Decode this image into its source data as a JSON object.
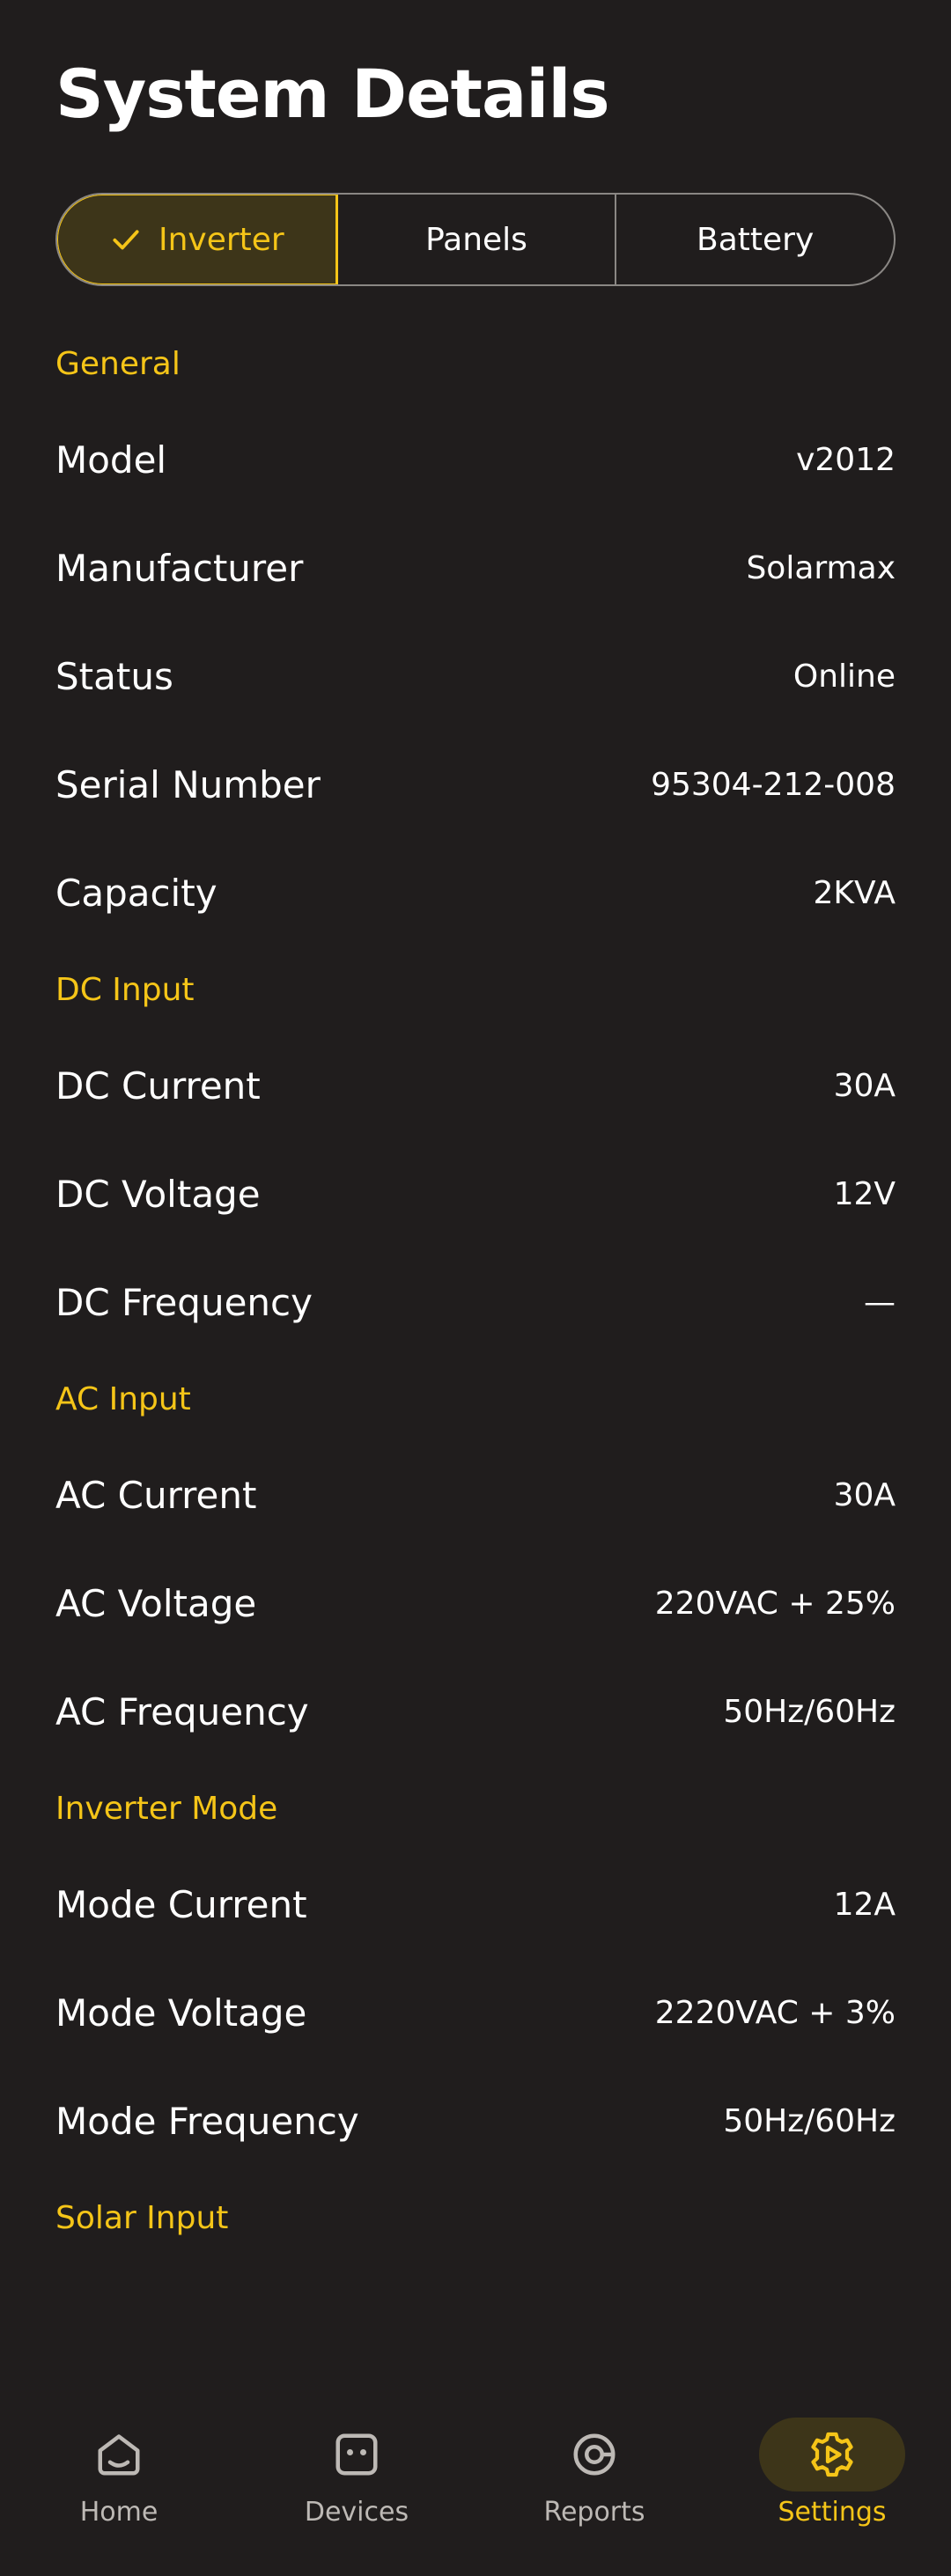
{
  "title": "System Details",
  "tabs": [
    {
      "label": "Inverter",
      "selected": true
    },
    {
      "label": "Panels",
      "selected": false
    },
    {
      "label": "Battery",
      "selected": false
    }
  ],
  "sections": [
    {
      "header": "General",
      "rows": [
        {
          "label": "Model",
          "value": "v2012"
        },
        {
          "label": "Manufacturer",
          "value": "Solarmax"
        },
        {
          "label": "Status",
          "value": "Online"
        },
        {
          "label": "Serial Number",
          "value": "95304-212-008"
        },
        {
          "label": "Capacity",
          "value": "2KVA"
        }
      ]
    },
    {
      "header": "DC Input",
      "rows": [
        {
          "label": "DC Current",
          "value": "30A"
        },
        {
          "label": "DC Voltage",
          "value": "12V"
        },
        {
          "label": "DC Frequency",
          "value": "—"
        }
      ]
    },
    {
      "header": "AC Input",
      "rows": [
        {
          "label": "AC Current",
          "value": "30A"
        },
        {
          "label": "AC Voltage",
          "value": "220VAC + 25%"
        },
        {
          "label": "AC Frequency",
          "value": "50Hz/60Hz"
        }
      ]
    },
    {
      "header": "Inverter Mode",
      "rows": [
        {
          "label": "Mode Current",
          "value": "12A"
        },
        {
          "label": "Mode Voltage",
          "value": "2220VAC + 3%"
        },
        {
          "label": "Mode Frequency",
          "value": "50Hz/60Hz"
        }
      ]
    },
    {
      "header": "Solar Input",
      "rows": []
    }
  ],
  "nav": [
    {
      "label": "Home",
      "icon": "home-icon",
      "active": false
    },
    {
      "label": "Devices",
      "icon": "devices-icon",
      "active": false
    },
    {
      "label": "Reports",
      "icon": "reports-icon",
      "active": false
    },
    {
      "label": "Settings",
      "icon": "settings-icon",
      "active": true
    }
  ],
  "colors": {
    "background": "#201d1d",
    "accent": "#f5c518",
    "accent_bg": "#3d3519"
  }
}
